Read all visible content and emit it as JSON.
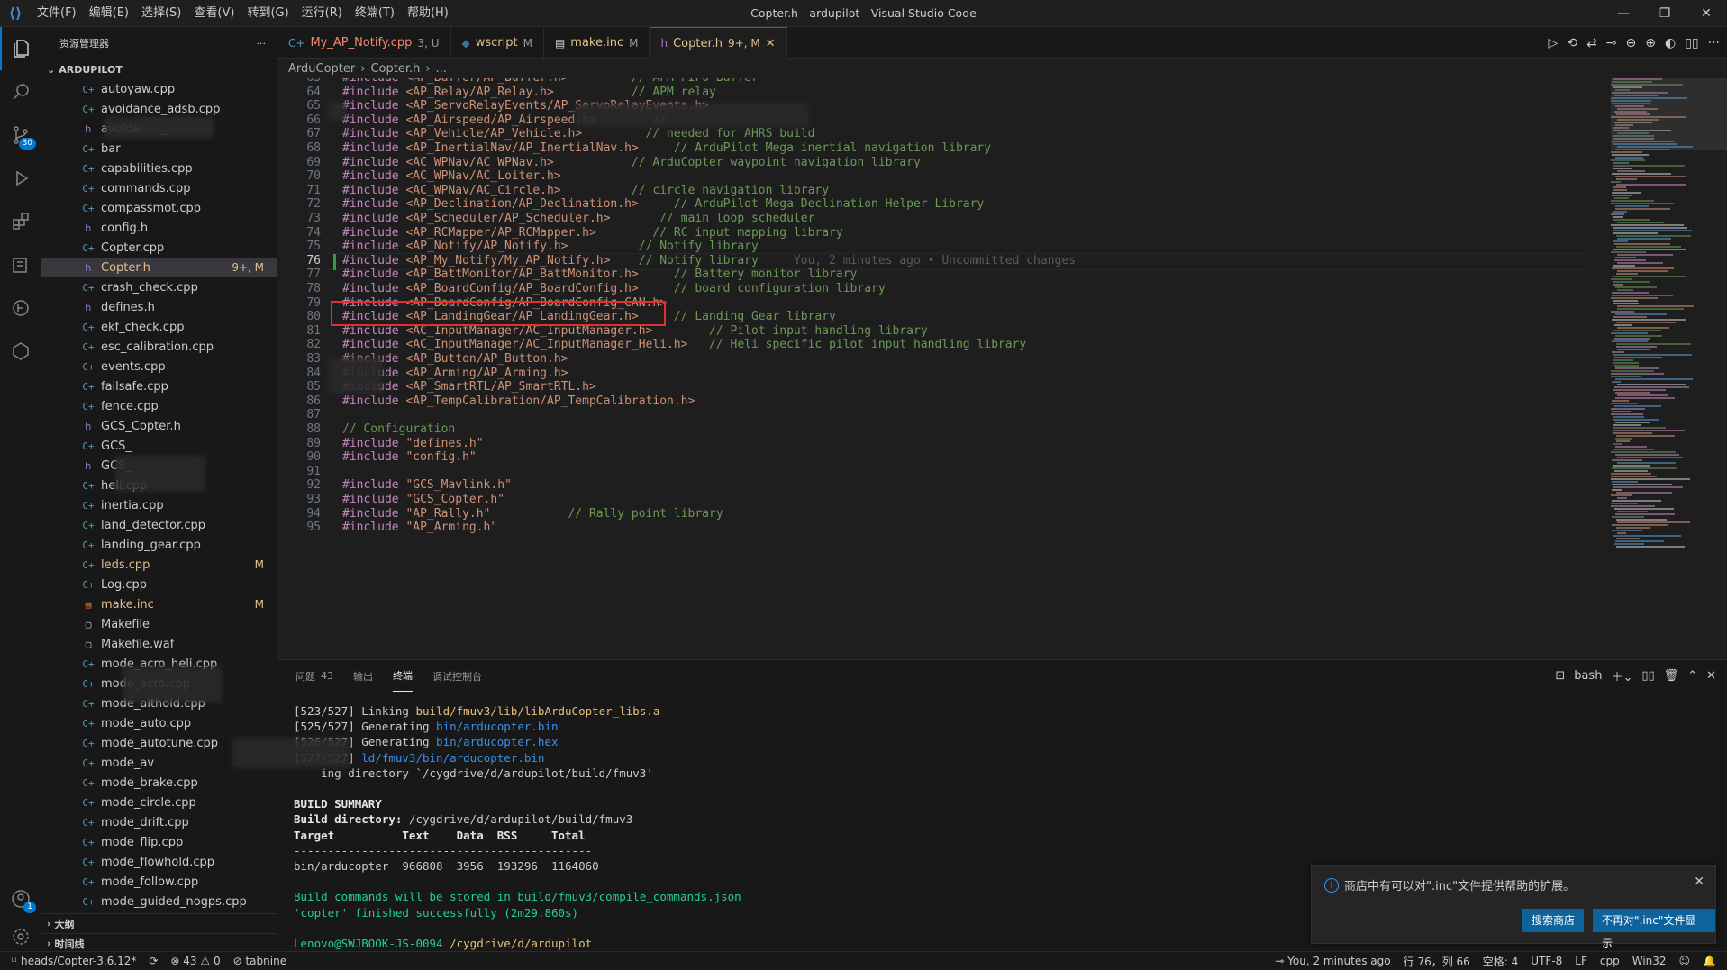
{
  "titlebar": {
    "menu": [
      "文件(F)",
      "编辑(E)",
      "选择(S)",
      "查看(V)",
      "转到(G)",
      "运行(R)",
      "终端(T)",
      "帮助(H)"
    ],
    "title": "Copter.h - ardupilot - Visual Studio Code"
  },
  "sidebar": {
    "header": "资源管理器",
    "root": "ARDUPILOT",
    "files": [
      {
        "name": "autoyaw.cpp",
        "type": "cpp",
        "status": ""
      },
      {
        "name": "avoidance_adsb.cpp",
        "type": "cpp",
        "status": ""
      },
      {
        "name": "avoidance_adsb.h",
        "type": "h",
        "status": ""
      },
      {
        "name": "bar",
        "type": "cpp",
        "status": ""
      },
      {
        "name": "capabilities.cpp",
        "type": "cpp",
        "status": ""
      },
      {
        "name": "commands.cpp",
        "type": "cpp",
        "status": ""
      },
      {
        "name": "compassmot.cpp",
        "type": "cpp",
        "status": ""
      },
      {
        "name": "config.h",
        "type": "h",
        "status": ""
      },
      {
        "name": "Copter.cpp",
        "type": "cpp",
        "status": ""
      },
      {
        "name": "Copter.h",
        "type": "h",
        "status": "9+, M"
      },
      {
        "name": "crash_check.cpp",
        "type": "cpp",
        "status": ""
      },
      {
        "name": "defines.h",
        "type": "h",
        "status": ""
      },
      {
        "name": "ekf_check.cpp",
        "type": "cpp",
        "status": ""
      },
      {
        "name": "esc_calibration.cpp",
        "type": "cpp",
        "status": ""
      },
      {
        "name": "events.cpp",
        "type": "cpp",
        "status": ""
      },
      {
        "name": "failsafe.cpp",
        "type": "cpp",
        "status": ""
      },
      {
        "name": "fence.cpp",
        "type": "cpp",
        "status": ""
      },
      {
        "name": "GCS_Copter.h",
        "type": "h",
        "status": ""
      },
      {
        "name": "GCS_",
        "type": "cpp",
        "status": ""
      },
      {
        "name": "GCS_",
        "type": "h",
        "status": ""
      },
      {
        "name": "heli.cpp",
        "type": "cpp",
        "status": ""
      },
      {
        "name": "inertia.cpp",
        "type": "cpp",
        "status": ""
      },
      {
        "name": "land_detector.cpp",
        "type": "cpp",
        "status": ""
      },
      {
        "name": "landing_gear.cpp",
        "type": "cpp",
        "status": ""
      },
      {
        "name": "leds.cpp",
        "type": "cpp",
        "status": "M"
      },
      {
        "name": "Log.cpp",
        "type": "cpp",
        "status": ""
      },
      {
        "name": "make.inc",
        "type": "mk",
        "status": "M"
      },
      {
        "name": "Makefile",
        "type": "file",
        "status": ""
      },
      {
        "name": "Makefile.waf",
        "type": "file",
        "status": ""
      },
      {
        "name": "mode_acro_heli.cpp",
        "type": "cpp",
        "status": ""
      },
      {
        "name": "mode_acro.cpp",
        "type": "cpp",
        "status": ""
      },
      {
        "name": "mode_althold.cpp",
        "type": "cpp",
        "status": ""
      },
      {
        "name": "mode_auto.cpp",
        "type": "cpp",
        "status": ""
      },
      {
        "name": "mode_autotune.cpp",
        "type": "cpp",
        "status": ""
      },
      {
        "name": "mode_av",
        "type": "cpp",
        "status": ""
      },
      {
        "name": "mode_brake.cpp",
        "type": "cpp",
        "status": ""
      },
      {
        "name": "mode_circle.cpp",
        "type": "cpp",
        "status": ""
      },
      {
        "name": "mode_drift.cpp",
        "type": "cpp",
        "status": ""
      },
      {
        "name": "mode_flip.cpp",
        "type": "cpp",
        "status": ""
      },
      {
        "name": "mode_flowhold.cpp",
        "type": "cpp",
        "status": ""
      },
      {
        "name": "mode_follow.cpp",
        "type": "cpp",
        "status": ""
      },
      {
        "name": "mode_guided_nogps.cpp",
        "type": "cpp",
        "status": ""
      }
    ],
    "outline": "大纲",
    "timeline": "时间线"
  },
  "tabs": [
    {
      "label": "My_AP_Notify.cpp",
      "badge": "3, U",
      "icon": "C++"
    },
    {
      "label": "wscript",
      "badge": "M",
      "icon": "py"
    },
    {
      "label": "make.inc",
      "badge": "M",
      "icon": "mk"
    },
    {
      "label": "Copter.h",
      "badge": "9+, M",
      "icon": "h"
    }
  ],
  "breadcrumb": [
    "ArduCopter",
    "Copter.h",
    "..."
  ],
  "editor": {
    "lines": [
      {
        "n": "63",
        "inc": "<AP_Buffer/AP_Buffer.h>",
        "pad": "         ",
        "cmt": "// APM FIFO Buffer"
      },
      {
        "n": "64",
        "inc": "<AP_Relay/AP_Relay.h>",
        "pad": "           ",
        "cmt": "// APM relay"
      },
      {
        "n": "65",
        "inc": "<AP_ServoRelayEvents/AP_ServoRelayEvents.h>",
        "pad": "",
        "cmt": ""
      },
      {
        "n": "66",
        "inc": "<AP_Airspeed/AP_Airspeed.h>",
        "pad": "        ",
        "cmt": "// r"
      },
      {
        "n": "67",
        "inc": "<AP_Vehicle/AP_Vehicle.h>",
        "pad": "         ",
        "cmt": "// needed for AHRS build"
      },
      {
        "n": "68",
        "inc": "<AP_InertialNav/AP_InertialNav.h>",
        "pad": "     ",
        "cmt": "// ArduPilot Mega inertial navigation library"
      },
      {
        "n": "69",
        "inc": "<AC_WPNav/AC_WPNav.h>",
        "pad": "           ",
        "cmt": "// ArduCopter waypoint navigation library"
      },
      {
        "n": "70",
        "inc": "<AC_WPNav/AC_Loiter.h>",
        "pad": "",
        "cmt": ""
      },
      {
        "n": "71",
        "inc": "<AC_WPNav/AC_Circle.h>",
        "pad": "          ",
        "cmt": "// circle navigation library"
      },
      {
        "n": "72",
        "inc": "<AP_Declination/AP_Declination.h>",
        "pad": "     ",
        "cmt": "// ArduPilot Mega Declination Helper Library"
      },
      {
        "n": "73",
        "inc": "<AP_Scheduler/AP_Scheduler.h>",
        "pad": "       ",
        "cmt": "// main loop scheduler"
      },
      {
        "n": "74",
        "inc": "<AP_RCMapper/AP_RCMapper.h>",
        "pad": "        ",
        "cmt": "// RC input mapping library"
      },
      {
        "n": "75",
        "inc": "<AP_Notify/AP_Notify.h>",
        "pad": "          ",
        "cmt": "// Notify library"
      },
      {
        "n": "76",
        "inc": "<AP_My_Notify/My_AP_Notify.h>",
        "pad": "    ",
        "cmt": "// Notify library",
        "blame": "You, 2 minutes ago • Uncommitted changes"
      },
      {
        "n": "77",
        "inc": "<AP_BattMonitor/AP_BattMonitor.h>",
        "pad": "     ",
        "cmt": "// Battery monitor library"
      },
      {
        "n": "78",
        "inc": "<AP_BoardConfig/AP_BoardConfig.h>",
        "pad": "     ",
        "cmt": "// board configuration library"
      },
      {
        "n": "79",
        "inc": "<AP_BoardConfig/AP_BoardConfig_CAN.h>",
        "pad": "",
        "cmt": ""
      },
      {
        "n": "80",
        "inc": "<AP_LandingGear/AP_LandingGear.h>",
        "pad": "     ",
        "cmt": "// Landing Gear library"
      },
      {
        "n": "81",
        "inc": "<AC_InputManager/AC_InputManager.h>",
        "pad": "        ",
        "cmt": "// Pilot input handling library"
      },
      {
        "n": "82",
        "inc": "<AC_InputManager/AC_InputManager_Heli.h>",
        "pad": "   ",
        "cmt": "// Heli specific pilot input handling library"
      },
      {
        "n": "83",
        "inc": "<AP_Button/AP_Button.h>",
        "pad": "",
        "cmt": ""
      },
      {
        "n": "84",
        "inc": "<AP_Arming/AP_Arming.h>",
        "pad": "",
        "cmt": ""
      },
      {
        "n": "85",
        "inc": "<AP_SmartRTL/AP_SmartRTL.h>",
        "pad": "",
        "cmt": ""
      },
      {
        "n": "86",
        "inc": "<AP_TempCalibration/AP_TempCalibration.h>",
        "pad": "",
        "cmt": ""
      },
      {
        "n": "87",
        "inc": "",
        "pad": "",
        "cmt": ""
      },
      {
        "n": "88",
        "inc": "",
        "pad": "",
        "cmt": "// Configuration",
        "plain": true
      },
      {
        "n": "89",
        "inc": "\"defines.h\"",
        "pad": "",
        "cmt": ""
      },
      {
        "n": "90",
        "inc": "\"config.h\"",
        "pad": "",
        "cmt": ""
      },
      {
        "n": "91",
        "inc": "",
        "pad": "",
        "cmt": ""
      },
      {
        "n": "92",
        "inc": "\"GCS_Mavlink.h\"",
        "pad": "",
        "cmt": ""
      },
      {
        "n": "93",
        "inc": "\"GCS_Copter.h\"",
        "pad": "",
        "cmt": ""
      },
      {
        "n": "94",
        "inc": "\"AP_Rally.h\"",
        "pad": "           ",
        "cmt": "// Rally point library"
      },
      {
        "n": "95",
        "inc": "\"AP_Arming.h\"",
        "pad": "",
        "cmt": ""
      }
    ],
    "keyword": "#include"
  },
  "panel": {
    "tabs": [
      {
        "label": "问题",
        "count": "43"
      },
      {
        "label": "输出",
        "count": ""
      },
      {
        "label": "终端",
        "count": ""
      },
      {
        "label": "调试控制台",
        "count": ""
      }
    ],
    "shell": "bash",
    "terminal": [
      {
        "a": "[523/527] Linking ",
        "b": "build/fmuv3/lib/libArduCopter_libs.a",
        "cls": "ty"
      },
      {
        "a": "[525/527] Generating ",
        "b": "bin/arducopter.bin",
        "cls": "tb"
      },
      {
        "a": "[526/527] Generating ",
        "b": "bin/arducopter.hex",
        "cls": "tb"
      },
      {
        "a": "[527/527] ",
        "b": "ld/fmuv3/bin/arducopter.bin",
        "cls": "tb"
      },
      {
        "a": "    ing directory `/cygdrive/d/ardupilot/build/fmuv3'",
        "b": "",
        "cls": ""
      },
      {
        "a": "",
        "b": "",
        "cls": ""
      },
      {
        "a": "BUILD SUMMARY",
        "b": "",
        "cls": "",
        "bold": true
      },
      {
        "a": "Build directory: ",
        "b": "/cygdrive/d/ardupilot/build/fmuv3",
        "cls": "",
        "bold": true
      },
      {
        "a": "Target          Text    Data  BSS     Total",
        "b": "",
        "cls": "",
        "bold": true
      },
      {
        "a": "--------------------------------------------",
        "b": "",
        "cls": ""
      },
      {
        "a": "bin/arducopter  966808  3956  193296  1164060",
        "b": "",
        "cls": ""
      },
      {
        "a": "",
        "b": "",
        "cls": ""
      },
      {
        "a": "Build commands will be stored in build/fmuv3/compile_commands.json",
        "b": "",
        "cls": "",
        "green": true
      },
      {
        "a": "'copter' finished successfully (2m29.860s)",
        "b": "",
        "cls": "",
        "green": true
      },
      {
        "a": "",
        "b": "",
        "cls": ""
      },
      {
        "a": "Lenovo@SWJBOOK-JS-0094 ",
        "b": "/cygdrive/d/ardupilot",
        "cls": "ty",
        "green": true
      }
    ]
  },
  "toast": {
    "message": "商店中有可以对\".inc\"文件提供帮助的扩展。",
    "btn_search": "搜索商店",
    "btn_never": "不再对\".inc\"文件显示"
  },
  "statusbar": {
    "branch": "heads/Copter-3.6.12*",
    "problems": "⊗ 43 ⚠ 0",
    "tabnine": "tabnine",
    "blame": "You, 2 minutes ago",
    "position": "行 76，列 66",
    "spaces": "空格: 4",
    "encoding": "UTF-8",
    "eol": "LF",
    "language": "cpp",
    "platform": "Win32"
  },
  "activity": {
    "scm_badge": "30",
    "account_badge": "1"
  }
}
